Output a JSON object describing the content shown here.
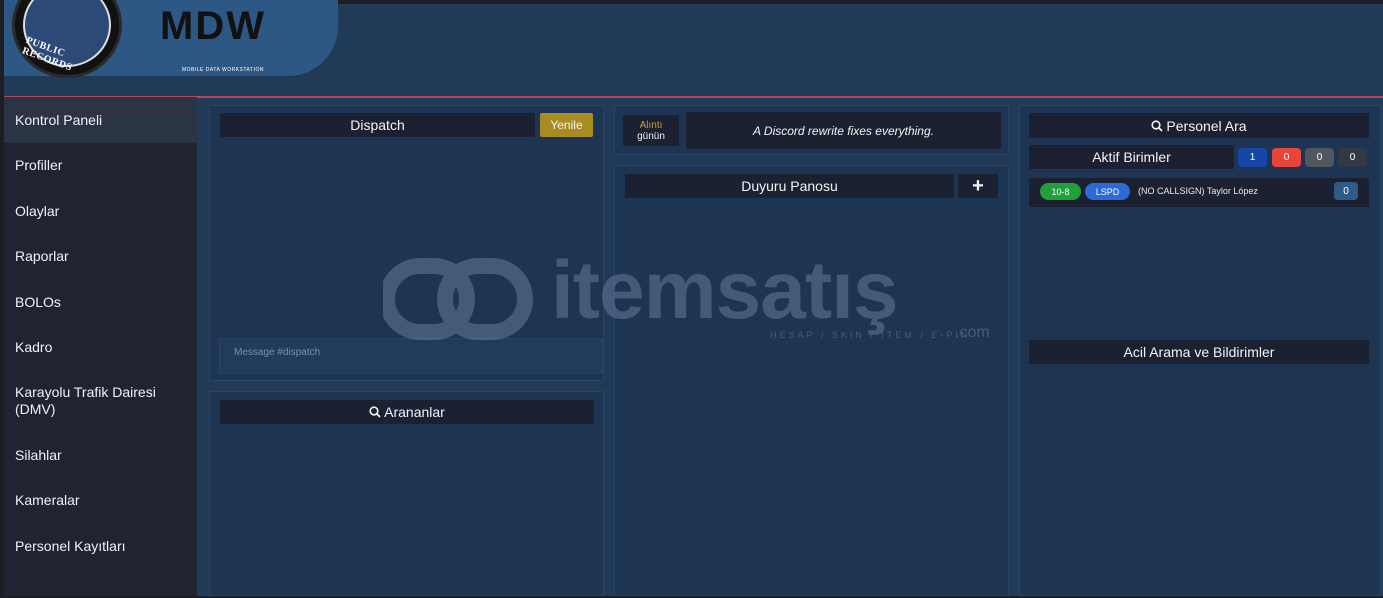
{
  "header": {
    "seal_text": "PUBLIC RECORDS",
    "app_title": "MDW",
    "app_subtitle": "MOBILE DATA WORKSTATION"
  },
  "sidebar": {
    "items": [
      {
        "label": "Kontrol Paneli",
        "active": true
      },
      {
        "label": "Profiller"
      },
      {
        "label": "Olaylar"
      },
      {
        "label": "Raporlar"
      },
      {
        "label": "BOLOs"
      },
      {
        "label": "Kadro"
      },
      {
        "label": "Karayolu Trafik Dairesi (DMV)"
      },
      {
        "label": "Silahlar"
      },
      {
        "label": "Kameralar"
      },
      {
        "label": "Personel Kayıtları"
      }
    ]
  },
  "dispatch": {
    "title": "Dispatch",
    "refresh_label": "Yenile",
    "message_placeholder": "Message #dispatch"
  },
  "wanted": {
    "title": "Arananlar"
  },
  "quote": {
    "label_top": "Alıntı",
    "label_bottom": "günün",
    "text": "A Discord rewrite fixes everything."
  },
  "bulletin": {
    "title": "Duyuru Panosu",
    "add_label": "+"
  },
  "personnel_search": {
    "title": "Personel Ara"
  },
  "active_units": {
    "title": "Aktif Birimler",
    "counts": [
      "1",
      "0",
      "0",
      "0"
    ],
    "count_colors": [
      "#1546a8",
      "#e8453a",
      "#52565e",
      "#333944"
    ],
    "units": [
      {
        "status": "10-8",
        "department": "LSPD",
        "name": "(NO CALLSIGN) Taylor López",
        "count": "0"
      }
    ]
  },
  "emergency": {
    "title": "Acil Arama ve Bildirimler"
  },
  "watermark": {
    "brand": "itemsatış",
    "tagline": "HESAP / SKIN / ITEM / E-PIN",
    "domain": ".com"
  }
}
